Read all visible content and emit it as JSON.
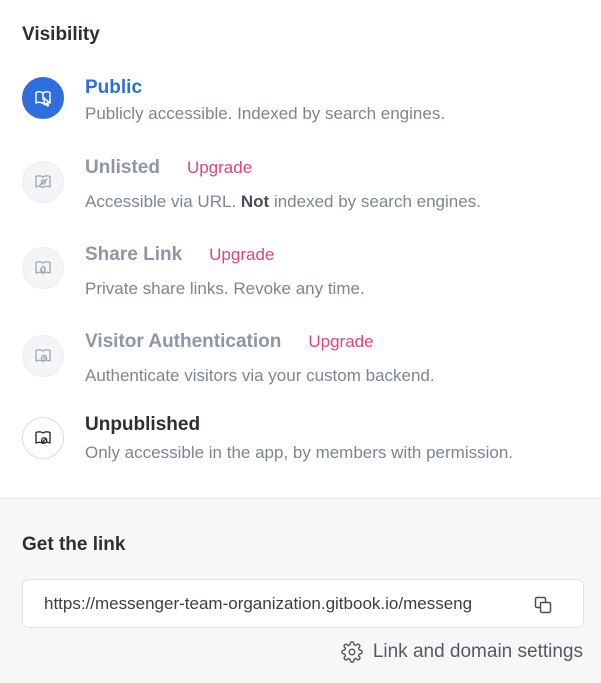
{
  "visibility": {
    "title": "Visibility",
    "options": [
      {
        "title": "Public",
        "description": "Publicly accessible. Indexed by search engines.",
        "icon": "book-cursor-icon",
        "state": "selected"
      },
      {
        "title": "Unlisted",
        "badge": "Upgrade",
        "description_parts": [
          "Accessible via URL. ",
          "Not",
          " indexed by search engines."
        ],
        "icon": "book-eye-off-icon",
        "state": "locked"
      },
      {
        "title": "Share Link",
        "badge": "Upgrade",
        "description": "Private share links. Revoke any time.",
        "icon": "book-link-icon",
        "state": "locked"
      },
      {
        "title": "Visitor Authentication",
        "badge": "Upgrade",
        "description": "Authenticate visitors via your custom backend.",
        "icon": "book-lock-icon",
        "state": "locked"
      },
      {
        "title": "Unpublished",
        "description": "Only accessible in the app, by members with permission.",
        "icon": "book-unpublished-icon",
        "state": "available"
      }
    ]
  },
  "get_link": {
    "title": "Get the link",
    "url": "https://messenger-team-organization.gitbook.io/messeng",
    "settings_label": "Link and domain settings"
  },
  "colors": {
    "accent": "#2f6fdd",
    "upgrade": "#e0457b",
    "muted": "#8e97a3"
  }
}
